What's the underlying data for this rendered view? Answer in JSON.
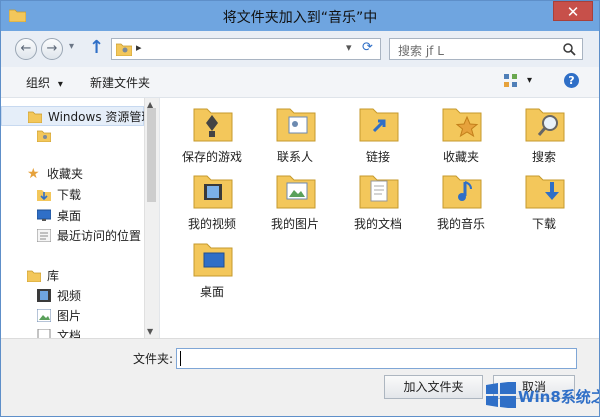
{
  "window": {
    "title": "将文件夹加入到“音乐”中",
    "close_glyph": "✕"
  },
  "address_bar": {
    "back_glyph": "←",
    "forward_glyph": "→",
    "up_glyph": "↑",
    "path_separator": "▸",
    "search_placeholder": "搜索 jf L",
    "dropdown_glyph": "▾",
    "refresh_glyph": "⟳"
  },
  "toolbar": {
    "organize_label": "组织",
    "organize_arrow": "▾",
    "new_folder_label": "新建文件夹",
    "view_arrow": "▾",
    "help_glyph": "?"
  },
  "sidebar": {
    "items": [
      {
        "label": "Windows 资源管理",
        "icon": "library-folder-icon"
      },
      {
        "label": "",
        "icon": "user-folder-icon"
      },
      {
        "label": "收藏夹",
        "icon": "star-icon"
      },
      {
        "label": "下载",
        "icon": "downloads-icon"
      },
      {
        "label": "桌面",
        "icon": "desktop-icon"
      },
      {
        "label": "最近访问的位置",
        "icon": "recent-icon"
      },
      {
        "label": "库",
        "icon": "library-icon"
      },
      {
        "label": "视频",
        "icon": "videos-icon"
      },
      {
        "label": "图片",
        "icon": "pictures-icon"
      },
      {
        "label": "文档",
        "icon": "documents-icon"
      }
    ]
  },
  "folders": [
    {
      "label": "保存的游戏",
      "icon": "saved-games-folder-icon"
    },
    {
      "label": "联系人",
      "icon": "contacts-folder-icon"
    },
    {
      "label": "链接",
      "icon": "links-folder-icon"
    },
    {
      "label": "收藏夹",
      "icon": "favorites-folder-icon"
    },
    {
      "label": "搜索",
      "icon": "searches-folder-icon"
    },
    {
      "label": "我的视频",
      "icon": "my-videos-folder-icon"
    },
    {
      "label": "我的图片",
      "icon": "my-pictures-folder-icon"
    },
    {
      "label": "我的文档",
      "icon": "my-documents-folder-icon"
    },
    {
      "label": "我的音乐",
      "icon": "my-music-folder-icon"
    },
    {
      "label": "下载",
      "icon": "downloads-folder-icon"
    },
    {
      "label": "桌面",
      "icon": "desktop-folder-icon"
    }
  ],
  "bottom": {
    "folder_label": "文件夹:",
    "folder_value": "",
    "add_button": "加入文件夹",
    "cancel_button": "取消"
  },
  "watermark": {
    "text": "Win8系统之家"
  },
  "colors": {
    "titlebar": "#6fa5e0",
    "close": "#c7504a",
    "folder": "#f3c75b",
    "accent": "#2f6fc7"
  }
}
